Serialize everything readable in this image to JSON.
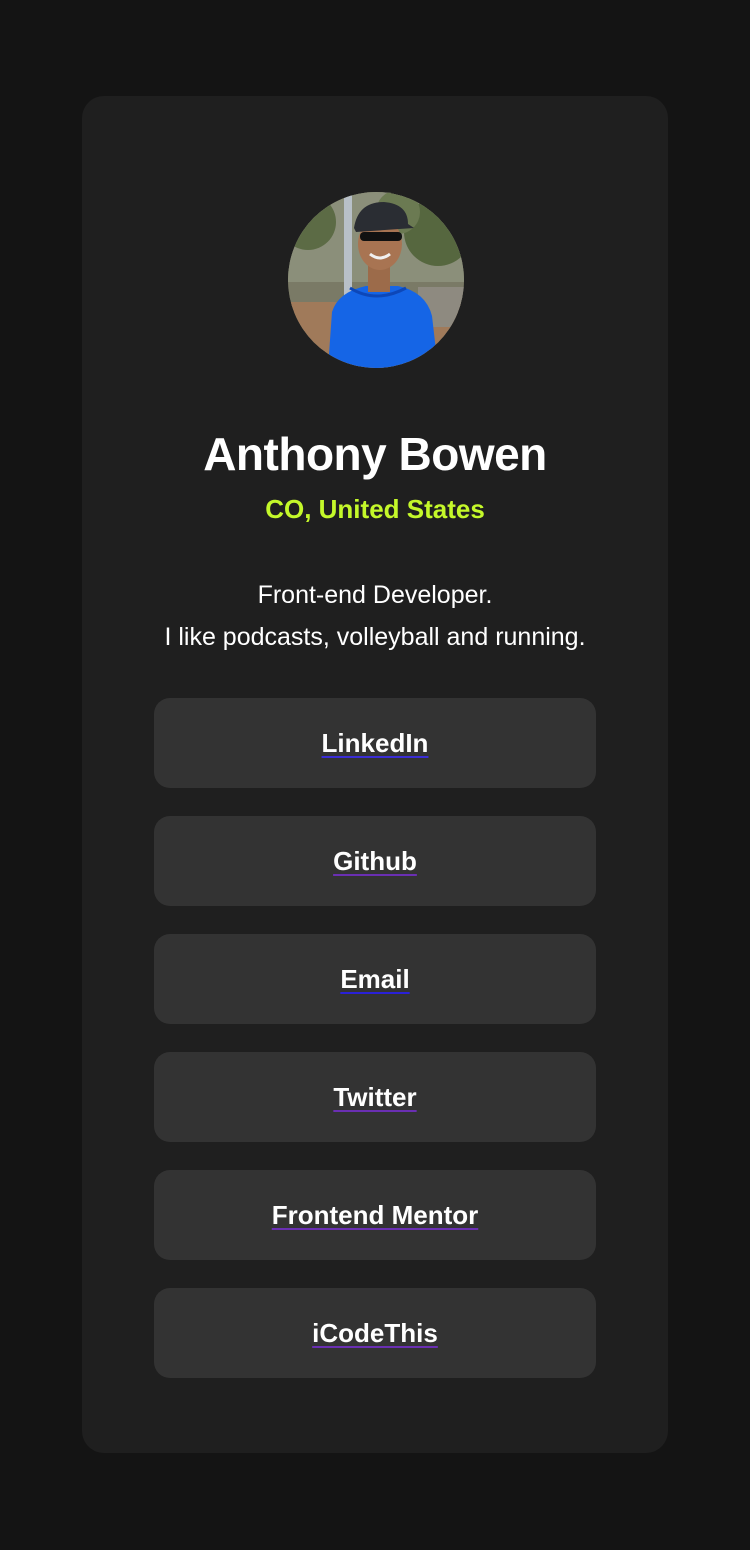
{
  "profile": {
    "avatar": "avatar-photo",
    "name": "Anthony Bowen",
    "location": "CO, United States",
    "bio": [
      "Front-end Developer.",
      "I like podcasts, volleyball and running."
    ]
  },
  "links": [
    {
      "label": "LinkedIn",
      "underline_color": "#3b2dd6"
    },
    {
      "label": "Github",
      "underline_color": "#6a2fb3"
    },
    {
      "label": "Email",
      "underline_color": "#2a20d8"
    },
    {
      "label": "Twitter",
      "underline_color": "#6a2fb3"
    },
    {
      "label": "Frontend Mentor",
      "underline_color": "#6a2fb3"
    },
    {
      "label": "iCodeThis",
      "underline_color": "#6a2fb3"
    }
  ],
  "colors": {
    "page_background": "#141414",
    "card_background": "#1f1f1f",
    "button_background": "#333333",
    "accent": "#c4f82a",
    "text": "#ffffff"
  }
}
